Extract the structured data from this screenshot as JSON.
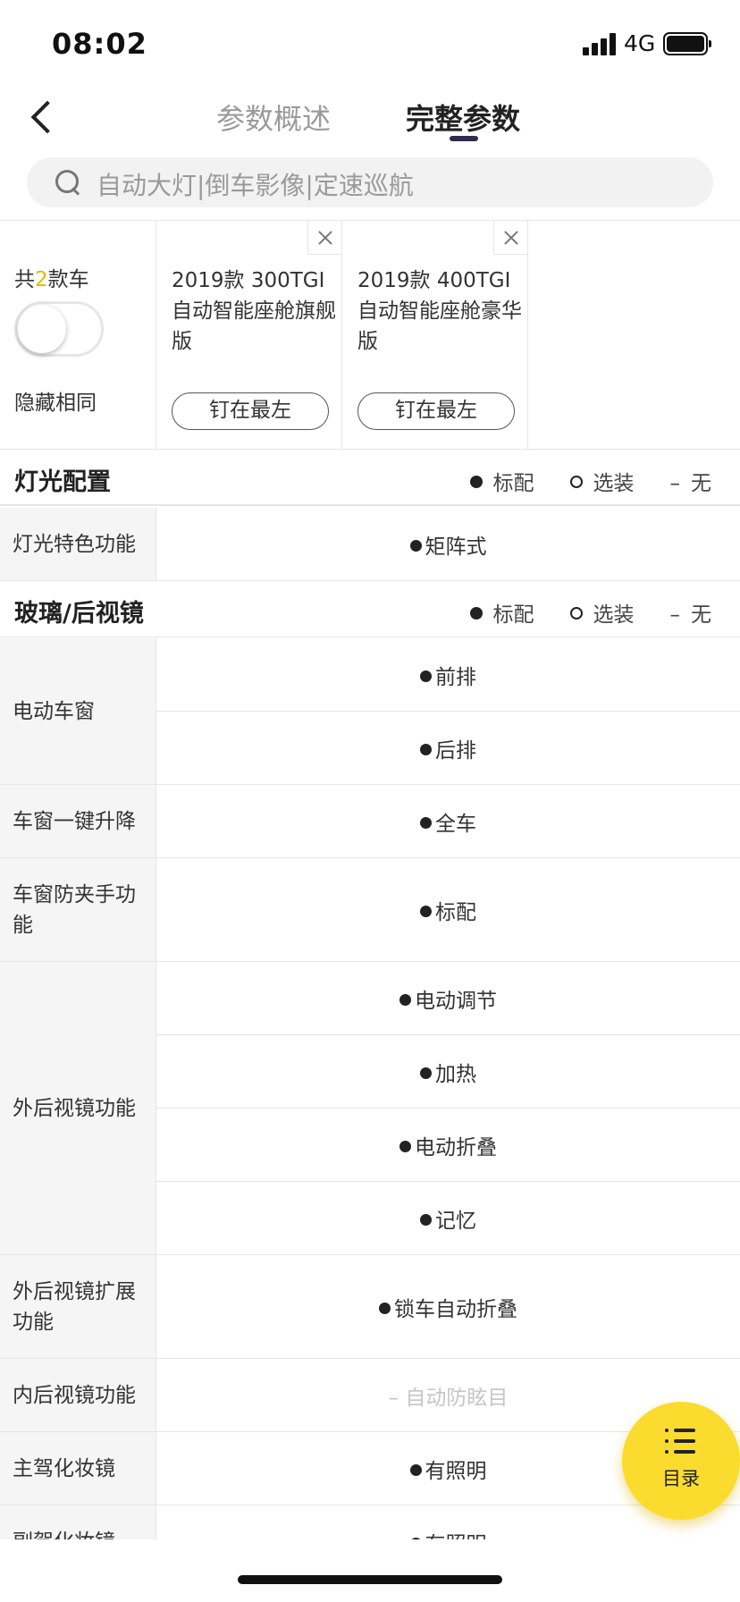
{
  "status_bar": {
    "time": "08:02",
    "network": "4G"
  },
  "nav": {
    "tabs": [
      {
        "label": "参数概述"
      },
      {
        "label": "完整参数"
      }
    ]
  },
  "search": {
    "placeholder": "自动大灯|倒车影像|定速巡航"
  },
  "compare": {
    "count_prefix": "共",
    "count": "2",
    "count_suffix": "款车",
    "hide_same_label": "隐藏相同",
    "hide_same_enabled": false,
    "cars": [
      {
        "name": "2019款 300TGI 自动智能座舱旗舰版",
        "pin_label": "钉在最左"
      },
      {
        "name": "2019款 400TGI 自动智能座舱豪华版",
        "pin_label": "钉在最左"
      }
    ]
  },
  "legend": {
    "standard": "标配",
    "optional": "选装",
    "none_symbol": "–",
    "none": "无"
  },
  "sections": [
    {
      "title": "灯光配置"
    },
    {
      "title": "玻璃/后视镜"
    }
  ],
  "rows": {
    "light_feature": {
      "label": "灯光特色功能",
      "values": [
        "矩阵式"
      ]
    },
    "power_window": {
      "label": "电动车窗",
      "values": [
        "前排",
        "后排"
      ]
    },
    "window_one_touch": {
      "label": "车窗一键升降",
      "values": [
        "全车"
      ]
    },
    "window_anti_pinch": {
      "label": "车窗防夹手功能",
      "values": [
        "标配"
      ]
    },
    "outer_mirror": {
      "label": "外后视镜功能",
      "values": [
        "电动调节",
        "加热",
        "电动折叠",
        "记忆"
      ]
    },
    "outer_mirror_ext": {
      "label": "外后视镜扩展功能",
      "values": [
        "锁车自动折叠"
      ]
    },
    "inner_mirror": {
      "label": "内后视镜功能",
      "none_symbol": "–",
      "value": "自动防眩目"
    },
    "driver_vanity": {
      "label": "主驾化妆镜",
      "values": [
        "有照明"
      ]
    },
    "passenger_vanity": {
      "label": "副驾化妆镜",
      "values": [
        "有照明"
      ]
    }
  },
  "fab": {
    "label": "目录"
  },
  "colors": {
    "accent_yellow": "#fbdc2e",
    "tab_underline": "#2e2c4a",
    "count_highlight": "#e6b800"
  }
}
